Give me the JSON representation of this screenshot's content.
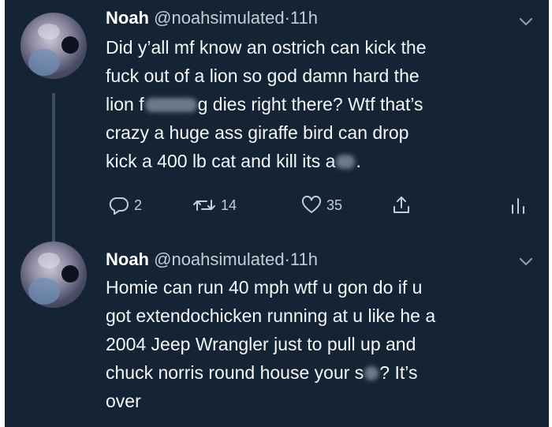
{
  "tweets": [
    {
      "name": "Noah",
      "handle": "@noahsimulated",
      "separator": "·",
      "time": "11h",
      "lines": [
        [
          "Did y’all mf know an ostrich can kick the"
        ],
        [
          "fuck out of a lion so god damn hard the"
        ],
        [
          "lion f",
          "g dies right there? Wtf that’s"
        ],
        [
          "crazy a huge ass giraffe bird can drop"
        ],
        [
          "kick a 400 lb cat and kill its a",
          "."
        ]
      ],
      "actions": {
        "replies": "2",
        "retweets": "14",
        "likes": "35"
      }
    },
    {
      "name": "Noah",
      "handle": "@noahsimulated",
      "separator": "·",
      "time": "11h",
      "lines": [
        [
          "Homie can run 40 mph wtf u gon do if u"
        ],
        [
          "got extendochicken running at u like he a"
        ],
        [
          "2004 Jeep Wrangler just to pull up and"
        ],
        [
          "chuck norris round house your s",
          "? It’s"
        ],
        [
          "over"
        ]
      ]
    }
  ],
  "icons": {
    "chevron": "chevron-down-icon",
    "reply": "reply-icon",
    "retweet": "retweet-icon",
    "like": "heart-icon",
    "share": "share-icon",
    "stats": "analytics-icon"
  },
  "colors": {
    "background": "#152435",
    "text": "#f4f6f8",
    "muted": "#c6ccd4",
    "thread_line": "#3c4d62"
  }
}
